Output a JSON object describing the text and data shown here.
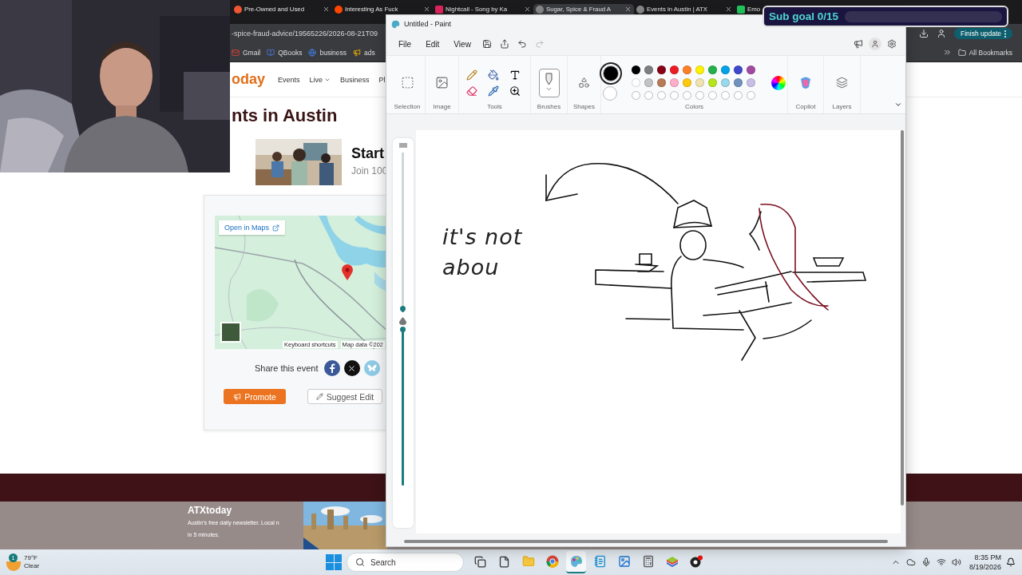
{
  "browser": {
    "tabs": [
      {
        "title": "Pre-Owned and Used",
        "selected": false
      },
      {
        "title": "Interesting As Fuck",
        "selected": false
      },
      {
        "title": "Nightcall - Song by Ka",
        "selected": false
      },
      {
        "title": "Sugar, Spice & Fraud A",
        "selected": true
      },
      {
        "title": "Events in Austin | ATX",
        "selected": false
      },
      {
        "title": "Emo",
        "selected": false
      }
    ],
    "url": "-spice-fraud-advice/19565226/2026-08-21T09",
    "update_button": "Finish update",
    "bookmarks": [
      "Gmail",
      "QBooks",
      "business",
      "ads"
    ],
    "all_bookmarks": "All Bookmarks"
  },
  "page": {
    "logo": "oday",
    "nav": [
      "Events",
      "Live",
      "Business",
      "Pl"
    ],
    "heading": "nts in Austin",
    "ad": {
      "title": "Start",
      "text": "Join 100"
    },
    "map": {
      "open_label": "Open in Maps",
      "shortcuts": "Keyboard shortcuts",
      "map_data": "Map data ©202"
    },
    "share_label": "Share this event",
    "share_buttons": [
      {
        "kind": "facebook"
      },
      {
        "kind": "x"
      },
      {
        "kind": "bluesky"
      }
    ],
    "promote": "Promote",
    "suggest": "Suggest Edit",
    "footer": {
      "logo": "ATXtoday",
      "text": "Austin's free daily newsletter. Local n",
      "text2": "in 5 minutes."
    }
  },
  "paint": {
    "title": "Untitled - Paint",
    "menu": [
      "File",
      "Edit",
      "View"
    ],
    "groups": [
      "Selection",
      "Image",
      "Tools",
      "Brushes",
      "Shapes",
      "Colors",
      "Copilot",
      "Layers"
    ],
    "current_colors": [
      {
        "color": "#000000",
        "selected": true
      },
      {
        "color": "#ffffff",
        "selected": false
      }
    ],
    "palette": [
      {
        "color": "#000000"
      },
      {
        "color": "#7f7f7f"
      },
      {
        "color": "#880015"
      },
      {
        "color": "#ed1c24"
      },
      {
        "color": "#ff7f27"
      },
      {
        "color": "#fff200"
      },
      {
        "color": "#22b14c"
      },
      {
        "color": "#00a2e8"
      },
      {
        "color": "#3f48cc"
      },
      {
        "color": "#a349a4"
      },
      {
        "color": "#ffffff"
      },
      {
        "color": "#c3c3c3"
      },
      {
        "color": "#b97a57"
      },
      {
        "color": "#ffaec9"
      },
      {
        "color": "#ffc90e"
      },
      {
        "color": "#efe4b0"
      },
      {
        "color": "#b5e61d"
      },
      {
        "color": "#99d9ea"
      },
      {
        "color": "#7092be"
      },
      {
        "color": "#c8bfe7"
      }
    ],
    "sliders": [
      {
        "level": 0.02
      },
      {
        "level": 1
      }
    ],
    "canvas_text": "it's not abou"
  },
  "sub_goal": {
    "label": "Sub goal 0/15",
    "level": 0
  },
  "taskbar": {
    "weather": {
      "temp": "79°F",
      "condition": "Clear",
      "badge": "1"
    },
    "search": "Search",
    "apps": [
      {
        "kind": "taskview",
        "selected": false
      },
      {
        "kind": "file",
        "selected": false
      },
      {
        "kind": "folder",
        "selected": false
      },
      {
        "kind": "browser",
        "selected": false
      },
      {
        "kind": "paint",
        "selected": true
      },
      {
        "kind": "notepad",
        "selected": false
      },
      {
        "kind": "photos",
        "selected": false
      },
      {
        "kind": "calculator",
        "selected": false
      },
      {
        "kind": "stack",
        "selected": false
      },
      {
        "kind": "recorder",
        "selected": false
      }
    ],
    "time": "8:35 PM",
    "date": "8/19/2026"
  }
}
